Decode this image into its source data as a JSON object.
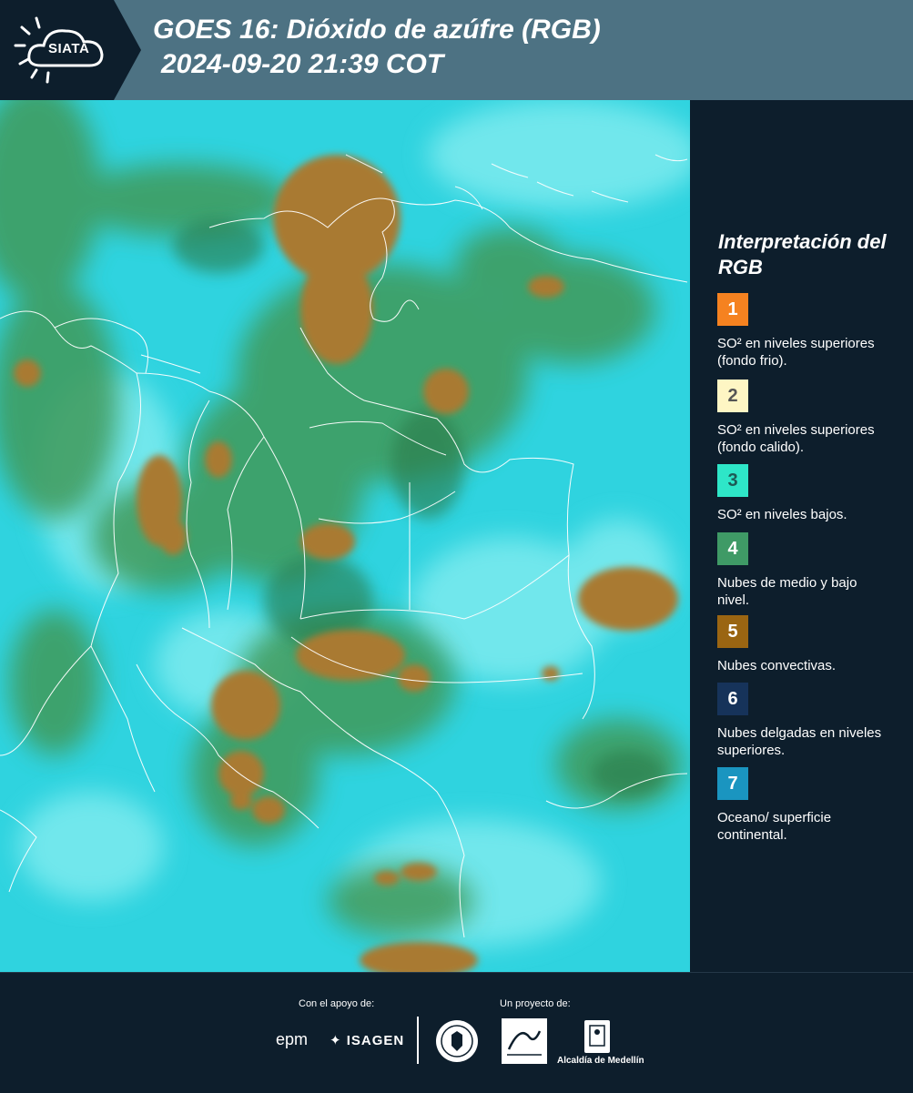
{
  "header": {
    "brand": "SIATA",
    "title_line1": "GOES 16: Dióxido de azúfre (RGB)",
    "title_line2": "2024-09-20 21:39 COT"
  },
  "legend": {
    "title": "Interpretación del RGB",
    "items": [
      {
        "number": "1",
        "color": "#f58220",
        "text_color": "#ffffff",
        "label": "SO² en niveles superiores (fondo frio)."
      },
      {
        "number": "2",
        "color": "#fef6c4",
        "text_color": "#555555",
        "label": "SO² en niveles superiores (fondo calido)."
      },
      {
        "number": "3",
        "color": "#2ee6c8",
        "text_color": "#1d5a55",
        "label": "SO² en niveles bajos."
      },
      {
        "number": "4",
        "color": "#3f9a66",
        "text_color": "#ffffff",
        "label": "Nubes de medio y bajo nivel."
      },
      {
        "number": "5",
        "color": "#9a6512",
        "text_color": "#ffffff",
        "label": "Nubes convectivas."
      },
      {
        "number": "6",
        "color": "#16335a",
        "text_color": "#ffffff",
        "label": "Nubes delgadas en niveles superiores."
      },
      {
        "number": "7",
        "color": "#1a95c0",
        "text_color": "#ffffff",
        "label": "Oceano/ superficie continental."
      }
    ]
  },
  "footer": {
    "support_label": "Con el apoyo de:",
    "project_label": "Un proyecto de:",
    "sponsors": [
      "epm",
      "ISAGEN"
    ],
    "partners": [
      "Alcaldía de Medellín"
    ]
  }
}
